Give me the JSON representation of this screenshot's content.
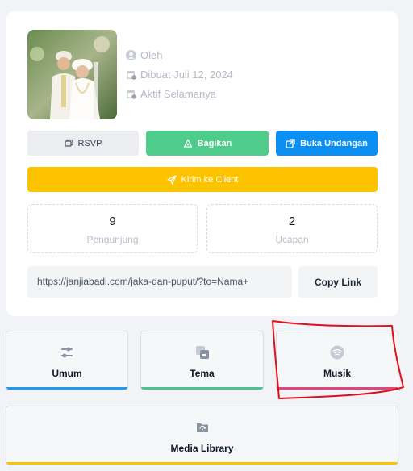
{
  "invitation": {
    "meta": {
      "owner": "Oleh",
      "created": "Dibuat Juli 12, 2024",
      "status": "Aktif Selamanya"
    },
    "actions": {
      "rsvp": "RSVP",
      "share": "Bagikan",
      "open": "Buka Undangan",
      "send": "Kirim ke Client"
    },
    "stats": [
      {
        "value": "9",
        "label": "Pengunjung"
      },
      {
        "value": "2",
        "label": "Ucapan"
      }
    ],
    "link": {
      "url": "https://janjiabadi.com/jaka-dan-puput/?to=Nama+",
      "copy_label": "Copy Link"
    }
  },
  "menu": [
    {
      "label": "Umum",
      "icon": "sliders-icon",
      "color": "#1e9bf0"
    },
    {
      "label": "Tema",
      "icon": "theme-icon",
      "color": "#4cc38a"
    },
    {
      "label": "Musik",
      "icon": "music-icon",
      "color": "#e0457b"
    },
    {
      "label": "Media Library",
      "icon": "media-library-icon",
      "color": "#f7c600"
    }
  ],
  "colors": {
    "share": "#4fcb8a",
    "open": "#0b8ff3",
    "send": "#fdc300",
    "annotation": "#e0101a"
  }
}
